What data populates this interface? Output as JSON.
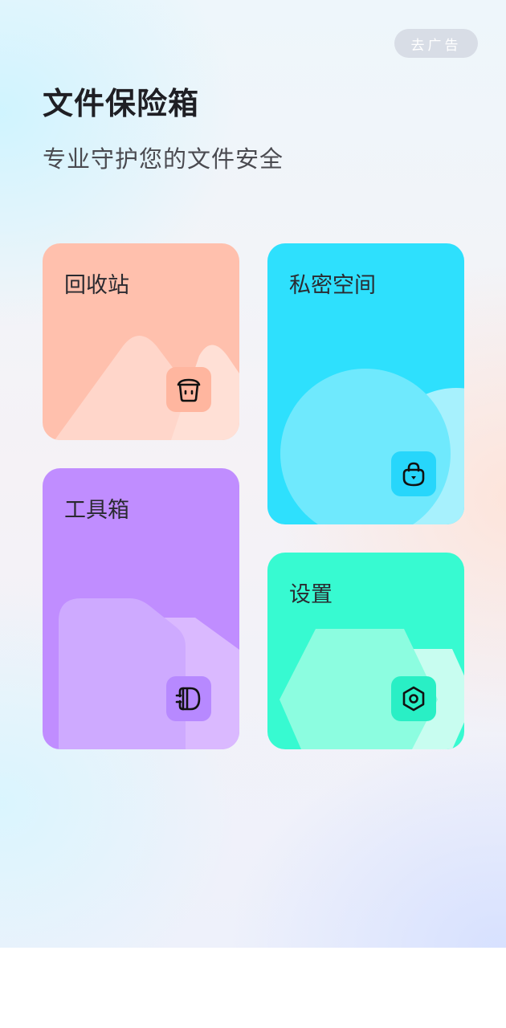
{
  "header": {
    "ad_button_label": "去广告",
    "title": "文件保险箱",
    "subtitle": "专业守护您的文件安全"
  },
  "cards": [
    {
      "id": "recycle",
      "label": "回收站",
      "icon": "trash-icon",
      "color": "#ffc0ad"
    },
    {
      "id": "private",
      "label": "私密空间",
      "icon": "lock-bag-icon",
      "color": "#2ee0fd"
    },
    {
      "id": "tools",
      "label": "工具箱",
      "icon": "toolbox-icon",
      "color": "#c08dff"
    },
    {
      "id": "settings",
      "label": "设置",
      "icon": "gear-icon",
      "color": "#37fad1"
    }
  ]
}
